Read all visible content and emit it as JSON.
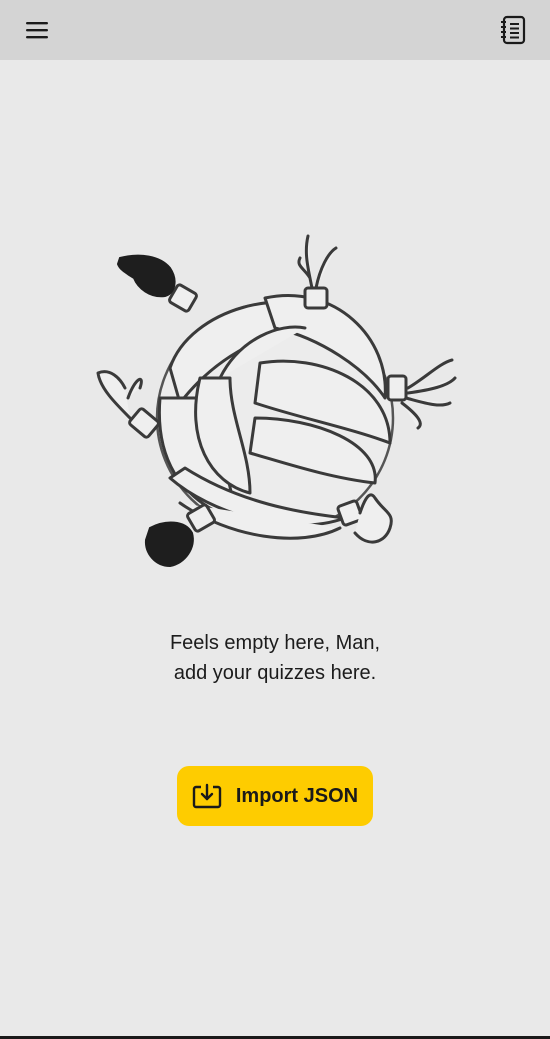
{
  "header": {
    "menu_icon": "hamburger-menu-icon",
    "notebook_icon": "notebook-icon"
  },
  "empty_state": {
    "line1": "Feels empty here, Man,",
    "line2": "add your quizzes here.",
    "illustration": "hands-around-knot-ball-illustration"
  },
  "import_button": {
    "label": "Import JSON",
    "icon": "download-tray-icon",
    "color": "#fecc00"
  },
  "colors": {
    "background": "#e9e9e9",
    "header": "#d4d4d4"
  }
}
